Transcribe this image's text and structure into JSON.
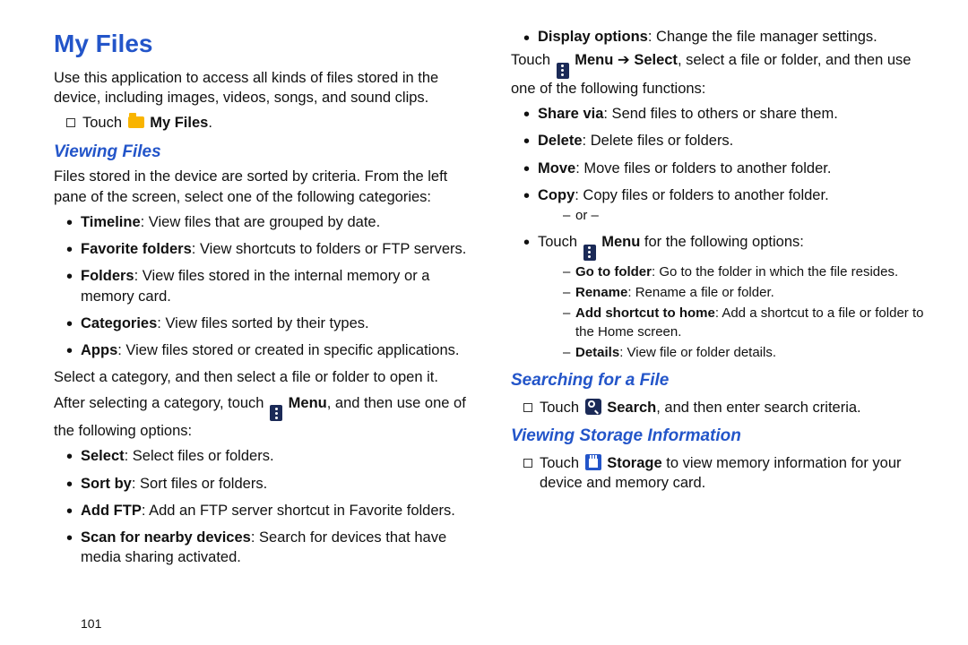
{
  "page_number": "101",
  "title": "My Files",
  "intro": "Use this application to access all kinds of files stored in the device, including images, videos, songs, and sound clips.",
  "touch_myfiles_pre": "Touch ",
  "touch_myfiles_label": "My Files",
  "touch_myfiles_post": ".",
  "sub1": "Viewing Files",
  "viewing_intro": "Files stored in the device are sorted by criteria. From the left pane of the screen, select one of the following categories:",
  "cat": {
    "timeline_b": "Timeline",
    "timeline_t": ": View files that are grouped by date.",
    "fav_b": "Favorite folders",
    "fav_t": ": View shortcuts to folders or FTP servers.",
    "folders_b": "Folders",
    "folders_t": ": View files stored in the internal memory or a memory card.",
    "categories_b": "Categories",
    "categories_t": ": View files sorted by their types.",
    "apps_b": "Apps",
    "apps_t": ": View files stored or created in specific applications."
  },
  "select_category": "Select a category, and then select a file or folder to open it.",
  "after_select_pre": "After selecting a category, touch ",
  "menu_word": "Menu",
  "after_select_post": ", and then use one of the following options:",
  "opt": {
    "select_b": "Select",
    "select_t": ": Select files or folders.",
    "sortby_b": "Sort by",
    "sortby_t": ": Sort files or folders.",
    "addftp_b": "Add FTP",
    "addftp_t": ": Add an FTP server shortcut in Favorite folders.",
    "scan_b": "Scan for nearby devices",
    "scan_t": ": Search for devices that have media sharing activated.",
    "disp_b": "Display options",
    "disp_t": ": Change the file manager settings."
  },
  "menu_select_pre": "Touch ",
  "menu_select_bold": "Menu",
  "arrow": " ➔ ",
  "select_bold": "Select",
  "menu_select_post": ", select a file or folder, and then use one of the following functions:",
  "fn": {
    "share_b": "Share via",
    "share_t": ": Send files to others or share them.",
    "delete_b": "Delete",
    "delete_t": ": Delete files or folders.",
    "move_b": "Move",
    "move_t": ": Move files or folders to another folder.",
    "copy_b": "Copy",
    "copy_t": ": Copy files or folders to another folder."
  },
  "or_text": "or –",
  "touch_menu_options_pre": "Touch ",
  "touch_menu_options_post": " for the following options:",
  "sub": {
    "goto_b": "Go to folder",
    "goto_t": ": Go to the folder in which the file resides.",
    "rename_b": "Rename",
    "rename_t": ": Rename a file or folder.",
    "addhome_b": "Add shortcut to home",
    "addhome_t": ": Add a shortcut to a file or folder to the Home screen.",
    "details_b": "Details",
    "details_t": ": View file or folder details."
  },
  "sub2": "Searching for a File",
  "search_pre": "Touch ",
  "search_bold": "Search",
  "search_post": ", and then enter search criteria.",
  "sub3": "Viewing Storage Information",
  "storage_pre": "Touch ",
  "storage_bold": "Storage",
  "storage_post": " to view memory information for your device and memory card."
}
